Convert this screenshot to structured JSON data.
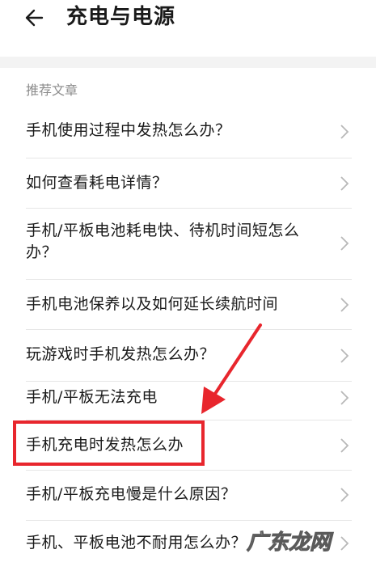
{
  "header": {
    "title": "充电与电源",
    "back_icon": "arrow-left-icon"
  },
  "section": {
    "label": "推荐文章"
  },
  "articles": [
    {
      "title": "手机使用过程中发热怎么办？"
    },
    {
      "title": "如何查看耗电详情？"
    },
    {
      "title": "手机/平板电池耗电快、待机时间短怎么办？"
    },
    {
      "title": "手机电池保养以及如何延长续航时间"
    },
    {
      "title": "玩游戏时手机发热怎么办？"
    },
    {
      "title": "手机/平板无法充电"
    },
    {
      "title": "手机充电时发热怎么办",
      "highlighted": true
    },
    {
      "title": "手机/平板充电慢是什么原因？"
    },
    {
      "title": "手机、平板电池不耐用怎么办？"
    }
  ],
  "watermark": {
    "text": "广东龙网"
  },
  "colors": {
    "annotation": "#e8262d",
    "divider": "#e6e6e6",
    "section_label": "#8c8c8c"
  }
}
